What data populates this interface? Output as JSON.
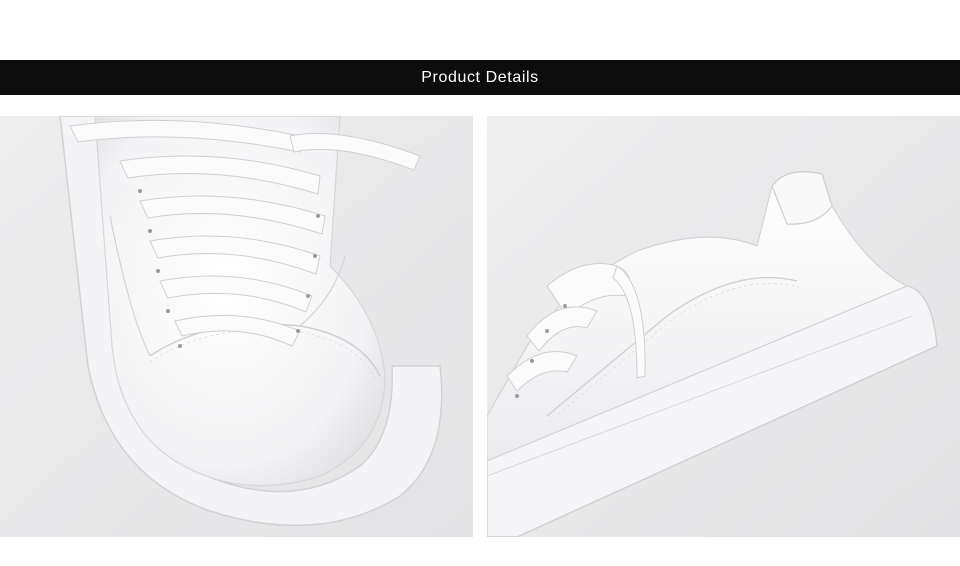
{
  "banner": {
    "title": "Product Details"
  },
  "photos": [
    {
      "name": "white-leather-sneaker-toe-closeup"
    },
    {
      "name": "white-leather-sneaker-side-heel-view"
    }
  ],
  "colors": {
    "banner_background": "#0d0d0d",
    "banner_text": "#ffffff",
    "photo_background": "#e9e9ea",
    "shoe_leather": "#f7f7f8"
  }
}
